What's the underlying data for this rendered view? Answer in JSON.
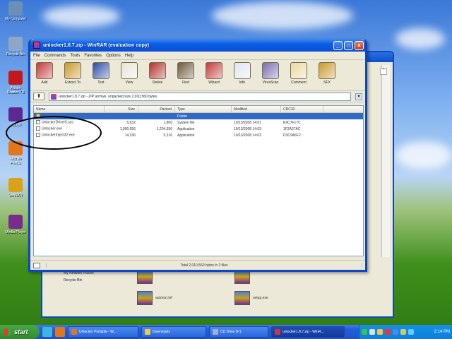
{
  "desktop": {
    "icons": [
      {
        "label": "My Computer",
        "icon": "my-computer-icon",
        "color": "#6d8fb5"
      },
      {
        "label": "Recycle Bin",
        "icon": "recycle-bin-icon",
        "color": "#8fa7c7"
      },
      {
        "label": "Adobe Reader 7.0",
        "icon": "adobe-reader-icon",
        "color": "#c21a1a"
      },
      {
        "label": "Yahoo!",
        "icon": "yahoo-icon",
        "color": "#5b2a91"
      },
      {
        "label": "Mozilla Firefox",
        "icon": "firefox-icon",
        "color": "#e2761b"
      },
      {
        "label": "WinRAR",
        "icon": "winrar-icon",
        "color": "#d9a21b"
      },
      {
        "label": "Media Player",
        "icon": "media-player-icon",
        "color": "#7a2b8f"
      }
    ]
  },
  "explorer": {
    "side_items": [
      "My Network Places",
      "Recycle Bin"
    ],
    "files": [
      {
        "name": "",
        "color": "#2a62c9"
      },
      {
        "name": "",
        "color": "#2a62c9"
      },
      {
        "name": "autorun.inf",
        "color": "#d9a21b"
      },
      {
        "name": "setup.exe",
        "color": "#d9a21b"
      }
    ]
  },
  "window": {
    "title": "unlocker1.8.7.zip - WinRAR (evaluation copy)",
    "menu": [
      "File",
      "Commands",
      "Tools",
      "Favorites",
      "Options",
      "Help"
    ],
    "toolbar": [
      {
        "label": "Add",
        "icon": "add-icon",
        "color": "#c23b3b"
      },
      {
        "label": "Extract To",
        "icon": "extract-to-icon",
        "color": "#c79a2b"
      },
      {
        "label": "Test",
        "icon": "test-icon",
        "color": "#2b4fa8"
      },
      {
        "label": "View",
        "icon": "view-icon",
        "color": "#e8e4d8"
      },
      {
        "label": "Delete",
        "icon": "delete-icon",
        "color": "#b3312f"
      },
      {
        "label": "Find",
        "icon": "find-icon",
        "color": "#6a5a3a"
      },
      {
        "label": "Wizard",
        "icon": "wizard-icon",
        "color": "#c23b3b"
      },
      {
        "label": "Info",
        "icon": "info-icon",
        "color": "#dfe6f2"
      },
      {
        "label": "VirusScan",
        "icon": "virus-scan-icon",
        "color": "#7a6bb0"
      },
      {
        "label": "Comment",
        "icon": "comment-icon",
        "color": "#e8d9a0"
      },
      {
        "label": "SFX",
        "icon": "sfx-icon",
        "color": "#c79a2b"
      }
    ],
    "address": "unlocker1.8.7.zip - ZIP archive, unpacked size 2,010,560 bytes",
    "columns": [
      "Name",
      "Size",
      "Packed",
      "Type",
      "Modified",
      "CRC32"
    ],
    "files": [
      {
        "name": "..",
        "size": "",
        "packed": "",
        "type": "Folder",
        "modified": "",
        "crc": "",
        "selected": true
      },
      {
        "name": "UnlockerDriver5.sys",
        "size": "5,632",
        "packed": "1,800",
        "type": "System file",
        "modified": "10/13/2008 14:01",
        "crc": "E9C7F17C",
        "selected": false
      },
      {
        "name": "Unlocker.exe",
        "size": "1,990,656",
        "packed": "1,204,356",
        "type": "Application",
        "modified": "10/13/2008 14:03",
        "crc": "1F2A27AC",
        "selected": false
      },
      {
        "name": "UnlockerInject32.exe",
        "size": "14,336",
        "packed": "5,316",
        "type": "Application",
        "modified": "10/13/2008 14:03",
        "crc": "D3C9A6F2",
        "selected": false
      }
    ],
    "status": "Total 2,010,560 bytes in 3 files"
  },
  "taskbar": {
    "start_label": "start",
    "tasks": [
      {
        "label": "Unlocker Portable - W...",
        "color": "#e2761b",
        "active": false
      },
      {
        "label": "Downloads",
        "color": "#f0c84a",
        "active": false
      },
      {
        "label": "CD Drive (F:)",
        "color": "#9ab0d0",
        "active": false
      },
      {
        "label": "unlocker1.8.7.zip - WinR...",
        "color": "#c23b3b",
        "active": true
      }
    ],
    "tray_colors": [
      "#3cc34a",
      "#e0e0e0",
      "#f0c84a",
      "#e33",
      "#4a8af0",
      "#cc6",
      "#6cf"
    ],
    "clock": "2:14 PM"
  }
}
